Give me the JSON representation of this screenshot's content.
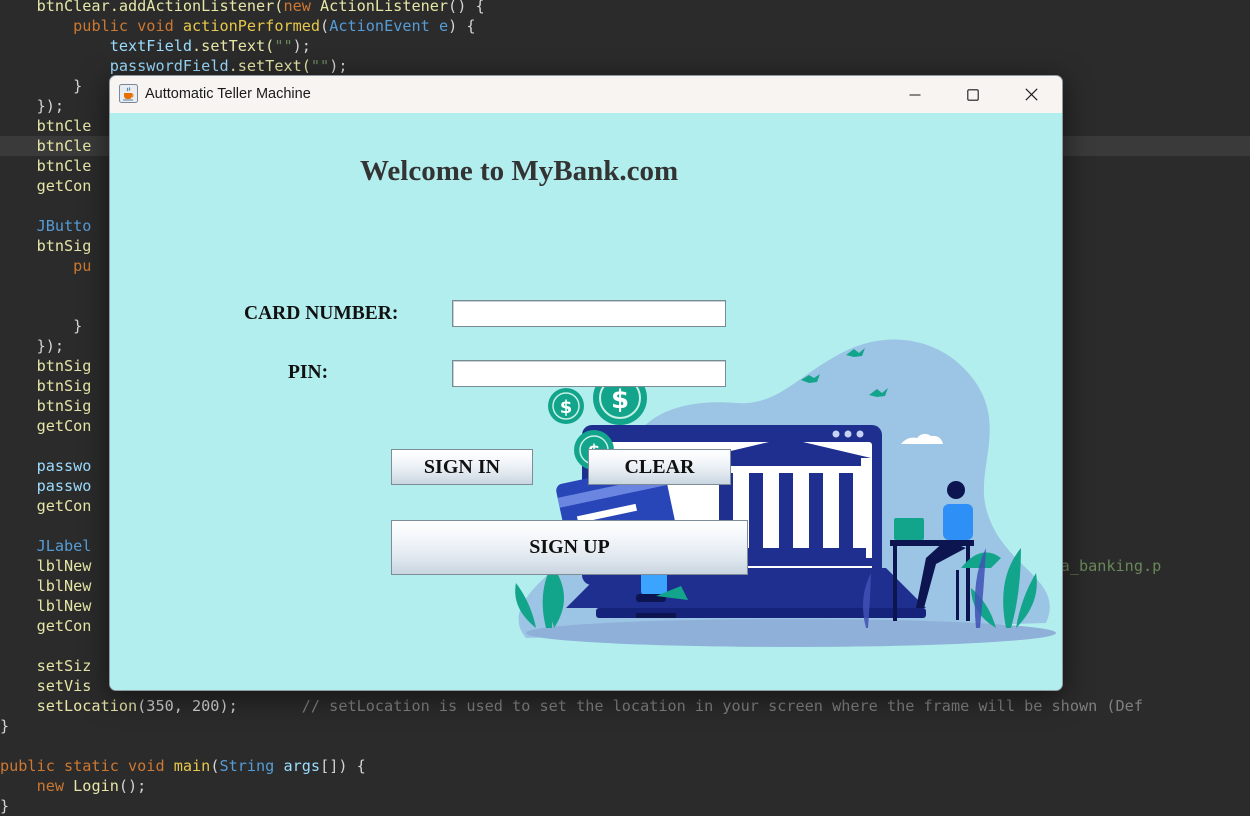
{
  "editor": {
    "lines": [
      [
        [
          "    btnClear.addActionListener(",
          "c-plain"
        ],
        [
          "new ",
          "c-kw"
        ],
        [
          "ActionListener",
          "c-plain"
        ],
        [
          "() {",
          "c-pun"
        ]
      ],
      [
        [
          "        ",
          "c-plain"
        ],
        [
          "public void ",
          "c-kw"
        ],
        [
          "actionPerformed",
          "c-fn"
        ],
        [
          "(",
          "c-pun"
        ],
        [
          "ActionEvent ",
          "c-type"
        ],
        [
          "e",
          "c-type"
        ],
        [
          ") {",
          "c-pun"
        ]
      ],
      [
        [
          "            ",
          "c-plain"
        ],
        [
          "textField",
          "c-var"
        ],
        [
          ".setText(",
          "c-plain"
        ],
        [
          "\"\"",
          "c-str"
        ],
        [
          ");",
          "c-pun"
        ]
      ],
      [
        [
          "            ",
          "c-plain"
        ],
        [
          "passwordField",
          "c-var"
        ],
        [
          ".setText(",
          "c-plain"
        ],
        [
          "\"\"",
          "c-str"
        ],
        [
          ");",
          "c-pun"
        ]
      ],
      [
        [
          "        }",
          "c-pun"
        ]
      ],
      [
        [
          "    });",
          "c-pun"
        ]
      ],
      [
        [
          "    btnCle",
          "c-plain"
        ]
      ],
      [
        [
          "    btnCle",
          "c-plain"
        ]
      ],
      [
        [
          "    btnCle",
          "c-plain"
        ]
      ],
      [
        [
          "    getCon",
          "c-plain"
        ]
      ],
      [
        [
          "",
          "c-plain"
        ]
      ],
      [
        [
          "    JButto",
          "c-type"
        ]
      ],
      [
        [
          "    btnSig",
          "c-plain"
        ]
      ],
      [
        [
          "        pu",
          "c-kw"
        ]
      ],
      [
        [
          "",
          "c-plain"
        ]
      ],
      [
        [
          "",
          "c-plain"
        ]
      ],
      [
        [
          "        }",
          "c-pun"
        ]
      ],
      [
        [
          "    });",
          "c-pun"
        ]
      ],
      [
        [
          "    btnSig",
          "c-plain"
        ]
      ],
      [
        [
          "    btnSig",
          "c-plain"
        ]
      ],
      [
        [
          "    btnSig",
          "c-plain"
        ]
      ],
      [
        [
          "    getCon",
          "c-plain"
        ]
      ],
      [
        [
          "",
          "c-plain"
        ]
      ],
      [
        [
          "    passwo",
          "c-var"
        ]
      ],
      [
        [
          "    passwo",
          "c-var"
        ]
      ],
      [
        [
          "    getCon",
          "c-plain"
        ]
      ],
      [
        [
          "",
          "c-plain"
        ]
      ],
      [
        [
          "    JLabel",
          "c-type"
        ]
      ],
      [
        [
          "    lblNew",
          "c-plain"
        ],
        [
          "                                                                                                  \\\\grafika_banking.p",
          "c-str"
        ]
      ],
      [
        [
          "    lblNew",
          "c-plain"
        ]
      ],
      [
        [
          "    lblNew",
          "c-plain"
        ]
      ],
      [
        [
          "    getCon",
          "c-plain"
        ]
      ],
      [
        [
          "",
          "c-plain"
        ]
      ],
      [
        [
          "    setSiz",
          "c-plain"
        ]
      ],
      [
        [
          "    setVis",
          "c-plain"
        ]
      ],
      [
        [
          "    setLocation",
          "c-plain"
        ],
        [
          "(350, 200);",
          "c-pun"
        ],
        [
          "       // setLocation is used to set the location in your screen where the frame will be shown (Def",
          "c-cm"
        ]
      ],
      [
        [
          "}",
          "c-pun"
        ]
      ],
      [
        [
          "",
          "c-plain"
        ]
      ],
      [
        [
          "public static void ",
          "c-kw"
        ],
        [
          "main",
          "c-fn"
        ],
        [
          "(",
          "c-pun"
        ],
        [
          "String ",
          "c-type"
        ],
        [
          "args",
          "c-var"
        ],
        [
          "[]) {",
          "c-pun"
        ]
      ],
      [
        [
          "    ",
          "c-plain"
        ],
        [
          "new ",
          "c-kw"
        ],
        [
          "Login",
          "c-plain"
        ],
        [
          "();",
          "c-pun"
        ]
      ],
      [
        [
          "}",
          "c-pun"
        ]
      ]
    ]
  },
  "window": {
    "title": "Auttomatic Teller Machine"
  },
  "form": {
    "heading": "Welcome to MyBank.com",
    "card_number_label": "CARD NUMBER:",
    "pin_label": "PIN:",
    "card_number_value": "",
    "pin_value": "",
    "sign_in_label": "SIGN IN",
    "clear_label": "CLEAR",
    "sign_up_label": "SIGN UP"
  },
  "icons": {
    "app": "java-coffee-cup-icon",
    "minimize": "minimize-icon",
    "maximize": "maximize-icon",
    "close": "close-icon"
  },
  "colors": {
    "content_background": "#b2eeee",
    "titlebar_background": "#f7f4f2",
    "editor_background": "#2b2b2b",
    "illustration_navy": "#1e2f8f",
    "illustration_teal": "#13a58b"
  }
}
